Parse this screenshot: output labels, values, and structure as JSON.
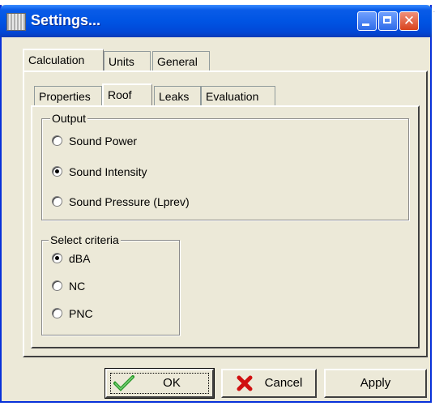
{
  "window": {
    "title": "Settings..."
  },
  "outer_tabs": [
    {
      "label": "Calculation",
      "active": true
    },
    {
      "label": "Units",
      "active": false
    },
    {
      "label": "General",
      "active": false
    }
  ],
  "inner_tabs": [
    {
      "label": "Properties",
      "active": false
    },
    {
      "label": "Roof",
      "active": true
    },
    {
      "label": "Leaks",
      "active": false
    },
    {
      "label": "Evaluation",
      "active": false
    }
  ],
  "output_group": {
    "title": "Output",
    "options": [
      {
        "label": "Sound Power",
        "checked": false
      },
      {
        "label": "Sound Intensity",
        "checked": true
      },
      {
        "label": "Sound Pressure (Lprev)",
        "checked": false
      }
    ]
  },
  "criteria_group": {
    "title": "Select criteria",
    "options": [
      {
        "label": "dBA",
        "checked": true
      },
      {
        "label": "NC",
        "checked": false
      },
      {
        "label": "PNC",
        "checked": false
      }
    ]
  },
  "buttons": {
    "ok": "OK",
    "cancel": "Cancel",
    "apply": "Apply"
  },
  "colors": {
    "titlebar": "#0054e3",
    "face": "#ece9d8",
    "ok_check": "#2a9a2a",
    "cancel_x": "#d01010"
  }
}
